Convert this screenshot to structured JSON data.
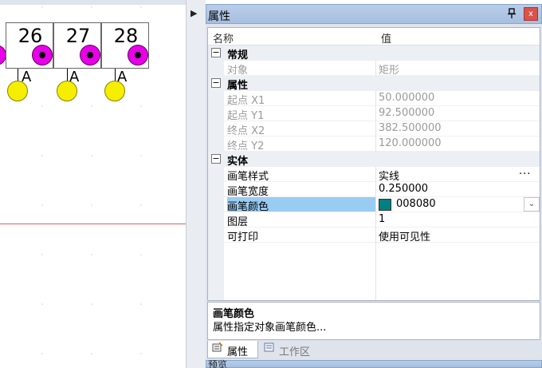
{
  "canvas": {
    "pins": [
      {
        "number": "26",
        "letter": "A"
      },
      {
        "number": "27",
        "letter": "A"
      },
      {
        "number": "28",
        "letter": "A"
      }
    ]
  },
  "strip": {
    "arrow": "▶"
  },
  "panel": {
    "title": "属性",
    "pin_icon": "pin-icon",
    "close_label": "x",
    "header": {
      "name_col": "名称",
      "value_col": "值"
    },
    "categories": [
      {
        "label": "常规",
        "toggle": "−",
        "props": [
          {
            "name": "对象",
            "value": "矩形",
            "readonly": true
          }
        ]
      },
      {
        "label": "属性",
        "toggle": "−",
        "props": [
          {
            "name": "起点 X1",
            "value": "50.000000",
            "readonly": true
          },
          {
            "name": "起点 Y1",
            "value": "92.500000",
            "readonly": true
          },
          {
            "name": "终点 X2",
            "value": "382.500000",
            "readonly": true
          },
          {
            "name": "终点 Y2",
            "value": "120.000000",
            "readonly": true
          }
        ]
      },
      {
        "label": "实体",
        "toggle": "−",
        "props": [
          {
            "name": "画笔样式",
            "value": "实线",
            "extra": "..."
          },
          {
            "name": "画笔宽度",
            "value": "0.250000"
          },
          {
            "name": "画笔颜色",
            "value": "008080",
            "swatch": "#008080",
            "selected": true,
            "dropdown": "⌄"
          },
          {
            "name": "图层",
            "value": "1"
          },
          {
            "name": "可打印",
            "value": "使用可见性"
          }
        ]
      }
    ],
    "description": {
      "title": "画笔颜色",
      "text": "属性指定对象画笔颜色..."
    },
    "tabs": [
      {
        "label": "属性",
        "icon": "properties-icon",
        "active": true
      },
      {
        "label": "工作区",
        "icon": "workspace-icon",
        "active": false
      }
    ],
    "bottom_title": "预览"
  },
  "colors": {
    "accent": "#008080",
    "selection": "#99ccf3",
    "pad": "#e800e8",
    "ball": "#f6ee00"
  }
}
